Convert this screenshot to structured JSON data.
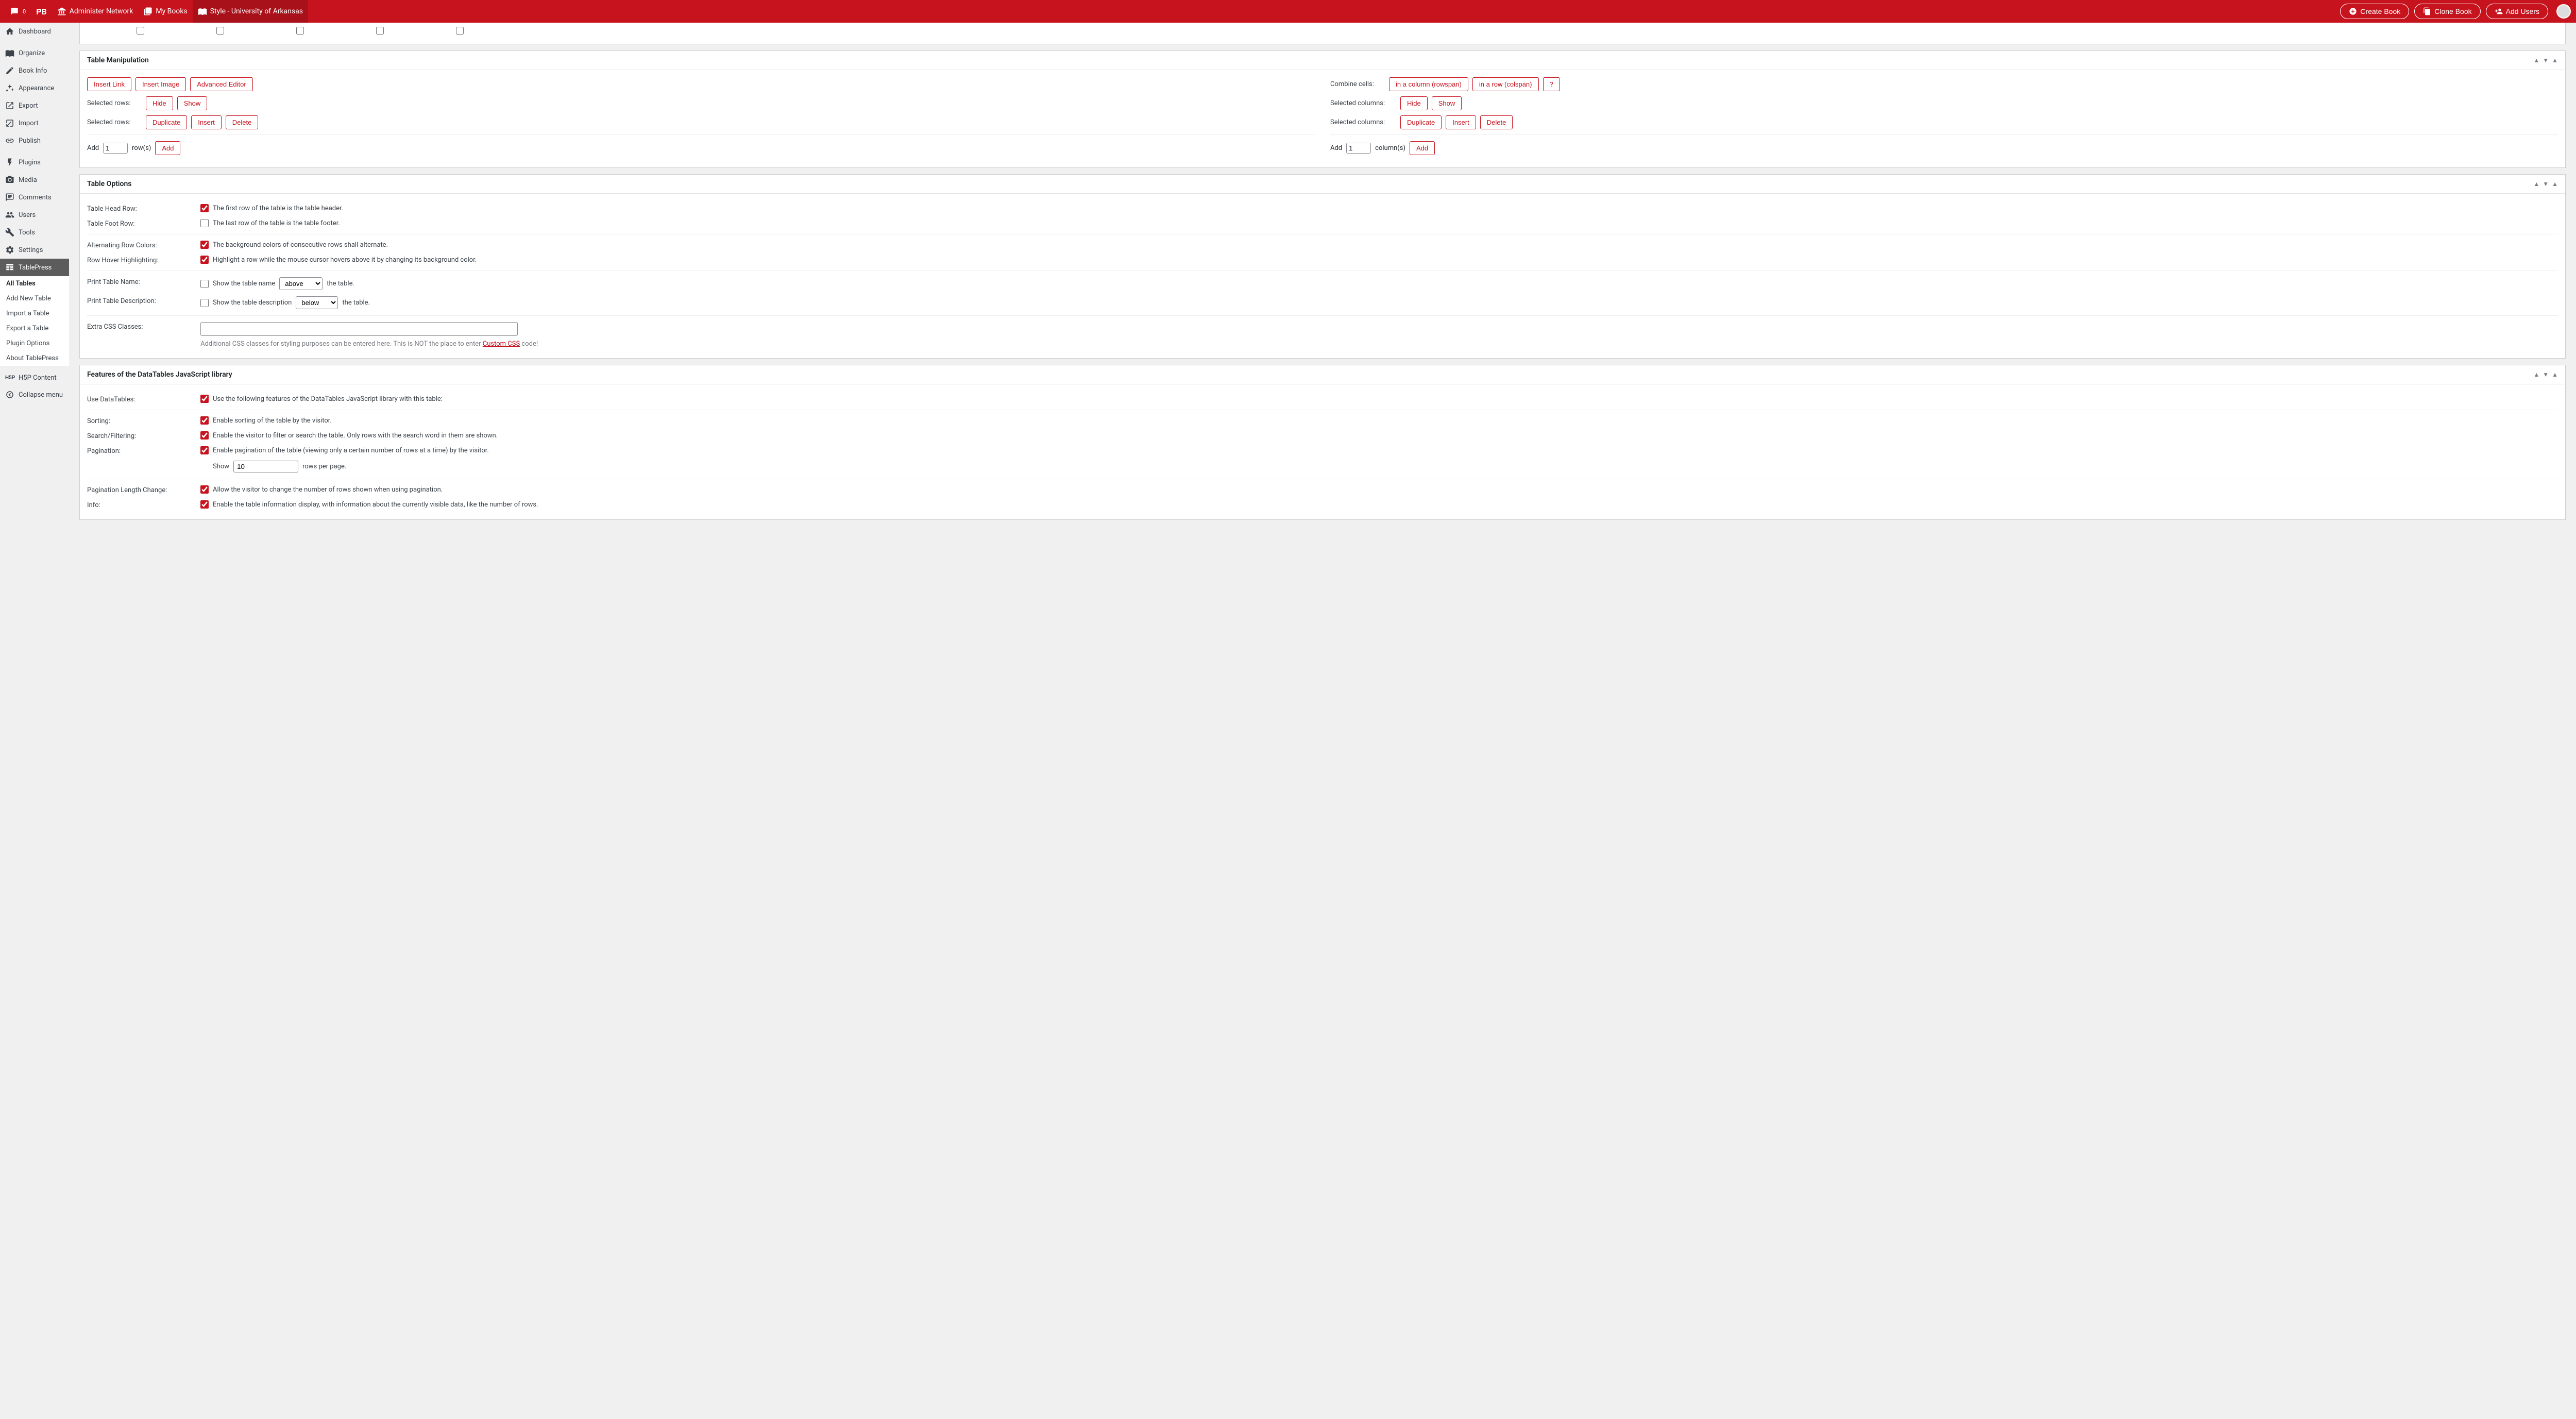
{
  "topbar": {
    "comment_count": "0",
    "pb": "PB",
    "admin_network": "Administer Network",
    "my_books": "My Books",
    "current_book": "Style - University of Arkansas",
    "create_book": "Create Book",
    "clone_book": "Clone Book",
    "add_users": "Add Users"
  },
  "sidebar": {
    "dashboard": "Dashboard",
    "organize": "Organize",
    "book_info": "Book Info",
    "appearance": "Appearance",
    "export": "Export",
    "import": "Import",
    "publish": "Publish",
    "plugins": "Plugins",
    "media": "Media",
    "comments": "Comments",
    "users": "Users",
    "tools": "Tools",
    "settings": "Settings",
    "tablepress": "TablePress",
    "sub": {
      "all_tables": "All Tables",
      "add_new_table": "Add New Table",
      "import_table": "Import a Table",
      "export_table": "Export a Table",
      "plugin_options": "Plugin Options",
      "about": "About TablePress"
    },
    "h5p": "H5P Content",
    "collapse": "Collapse menu"
  },
  "panels": {
    "manip": {
      "title": "Table Manipulation",
      "insert_link": "Insert Link",
      "insert_image": "Insert Image",
      "advanced_editor": "Advanced Editor",
      "selected_rows": "Selected rows:",
      "selected_columns": "Selected columns:",
      "combine_cells": "Combine cells:",
      "in_a_column": "in a column (rowspan)",
      "in_a_row": "in a row (colspan)",
      "help": "?",
      "hide": "Hide",
      "show": "Show",
      "duplicate": "Duplicate",
      "insert": "Insert",
      "delete": "Delete",
      "add_label1": "Add",
      "rows_val": "1",
      "rows_suffix": "row(s)",
      "add_btn": "Add",
      "cols_val": "1",
      "cols_suffix": "column(s)"
    },
    "options": {
      "title": "Table Options",
      "head_row_label": "Table Head Row:",
      "head_row_text": "The first row of the table is the table header.",
      "foot_row_label": "Table Foot Row:",
      "foot_row_text": "The last row of the table is the table footer.",
      "alt_colors_label": "Alternating Row Colors:",
      "alt_colors_text": "The background colors of consecutive rows shall alternate.",
      "hover_label": "Row Hover Highlighting:",
      "hover_text": "Highlight a row while the mouse cursor hovers above it by changing its background color.",
      "print_name_label": "Print Table Name:",
      "print_name_text1": "Show the table name",
      "print_name_sel": "above",
      "print_name_text2": "the table.",
      "print_desc_label": "Print Table Description:",
      "print_desc_text1": "Show the table description",
      "print_desc_sel": "below",
      "print_desc_text2": "the table.",
      "extra_css_label": "Extra CSS Classes:",
      "extra_css_hint1": "Additional CSS classes for styling purposes can be entered here. This is NOT the place to enter ",
      "extra_css_link": "Custom CSS",
      "extra_css_hint2": " code!"
    },
    "dt": {
      "title": "Features of the DataTables JavaScript library",
      "use_label": "Use DataTables:",
      "use_text": "Use the following features of the DataTables JavaScript library with this table:",
      "sorting_label": "Sorting:",
      "sorting_text": "Enable sorting of the table by the visitor.",
      "search_label": "Search/Filtering:",
      "search_text": "Enable the visitor to filter or search the table. Only rows with the search word in them are shown.",
      "pagination_label": "Pagination:",
      "pagination_text": "Enable pagination of the table (viewing only a certain number of rows at a time) by the visitor.",
      "show_label": "Show",
      "rows_per_page_val": "10",
      "rows_per_page": "rows per page.",
      "plc_label": "Pagination Length Change:",
      "plc_text": "Allow the visitor to change the number of rows shown when using pagination.",
      "info_label": "Info:",
      "info_text": "Enable the table information display, with information about the currently visible data, like the number of rows."
    }
  }
}
